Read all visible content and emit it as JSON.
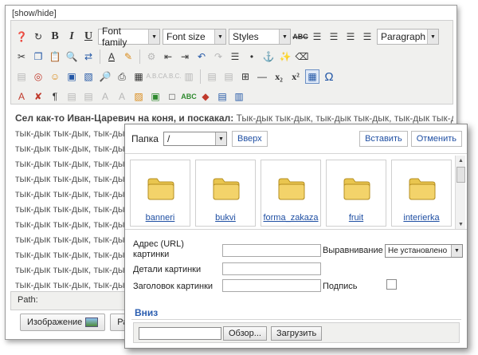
{
  "editor": {
    "showhide": "[show/hide]",
    "toolbar": {
      "font_family": "Font family",
      "font_size": "Font size",
      "styles": "Styles",
      "paragraph": "Paragraph"
    },
    "content": {
      "lead": "Сел как-то Иван-Царевич на коня, и поскакал:",
      "first_tail": " Тык-дык тык-дык, тык-дык тык-дык, тык-дык тык-дык,",
      "repeat_line": "тык-дык тык-дык, тык-дык тык-дык, тык-дык тык-дык, тык-дык тык-дык,"
    },
    "path_label": "Path:",
    "buttons": {
      "image": "Изображение",
      "other": "Разр"
    }
  },
  "dialog": {
    "folder_label": "Папка",
    "folder_value": "/",
    "up_button": "Вверх",
    "insert_button": "Вставить",
    "cancel_button": "Отменить",
    "folders": [
      "banneri",
      "bukvi",
      "forma_zakaza",
      "fruit",
      "interierka"
    ],
    "props": {
      "url_label": "Адрес (URL) картинки",
      "details_label": "Детали картинки",
      "title_label": "Заголовок картинки",
      "align_label": "Выравнивание",
      "align_value": "Не установлено",
      "caption_label": "Подпись"
    },
    "upload": {
      "section_title": "Вниз",
      "browse_button": "Обзор...",
      "upload_button": "Загрузить"
    }
  },
  "colors": {
    "link_blue": "#1f4fa3",
    "section_blue": "#2a5db0",
    "toolbar_bg": "#f0f0ee",
    "folder_yellow": "#f3d36a"
  }
}
